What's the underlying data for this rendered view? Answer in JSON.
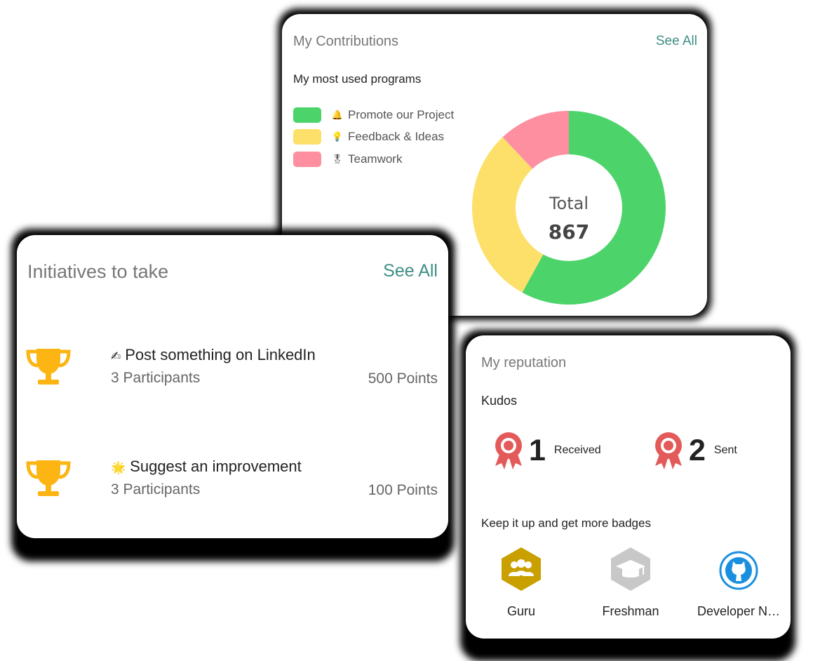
{
  "contributions": {
    "title": "My Contributions",
    "see_all": "See All",
    "subtitle": "My most used programs",
    "legend": [
      {
        "icon": "🔔",
        "label": "Promote our Project",
        "color": "#4cd46a"
      },
      {
        "icon": "💡",
        "label": "Feedback & Ideas",
        "color": "#fde06a"
      },
      {
        "icon": "🎖",
        "label": "Teamwork",
        "color": "#fd8fa0"
      }
    ],
    "center_label": "Total",
    "center_value": "867",
    "chart_data": {
      "type": "pie",
      "categories": [
        "Promote our Project",
        "Feedback & Ideas",
        "Teamwork"
      ],
      "values": [
        0.58,
        0.3,
        0.12
      ],
      "colors": [
        "#4cd46a",
        "#fde06a",
        "#fd8fa0"
      ]
    }
  },
  "initiatives": {
    "title": "Initiatives to take",
    "see_all": "See All",
    "items": [
      {
        "emoji": "✍",
        "title": "Post something on LinkedIn",
        "participants": "3 Participants",
        "points": "500 Points"
      },
      {
        "emoji": "🌟",
        "title": "Suggest an improvement",
        "participants": "3 Participants",
        "points": "100 Points"
      }
    ]
  },
  "reputation": {
    "title": "My reputation",
    "kudos_label": "Kudos",
    "received": {
      "count": "1",
      "label": "Received"
    },
    "sent": {
      "count": "2",
      "label": "Sent"
    },
    "badges_heading": "Keep it up and get more badges",
    "badges": [
      {
        "name": "Guru",
        "icon": "guru-badge-icon",
        "color": "#c9a000"
      },
      {
        "name": "Freshman",
        "icon": "graduation-cap-icon",
        "color": "#c8c8c8"
      },
      {
        "name": "Developer N…",
        "icon": "github-icon",
        "color": "#1a8fe0"
      }
    ]
  }
}
